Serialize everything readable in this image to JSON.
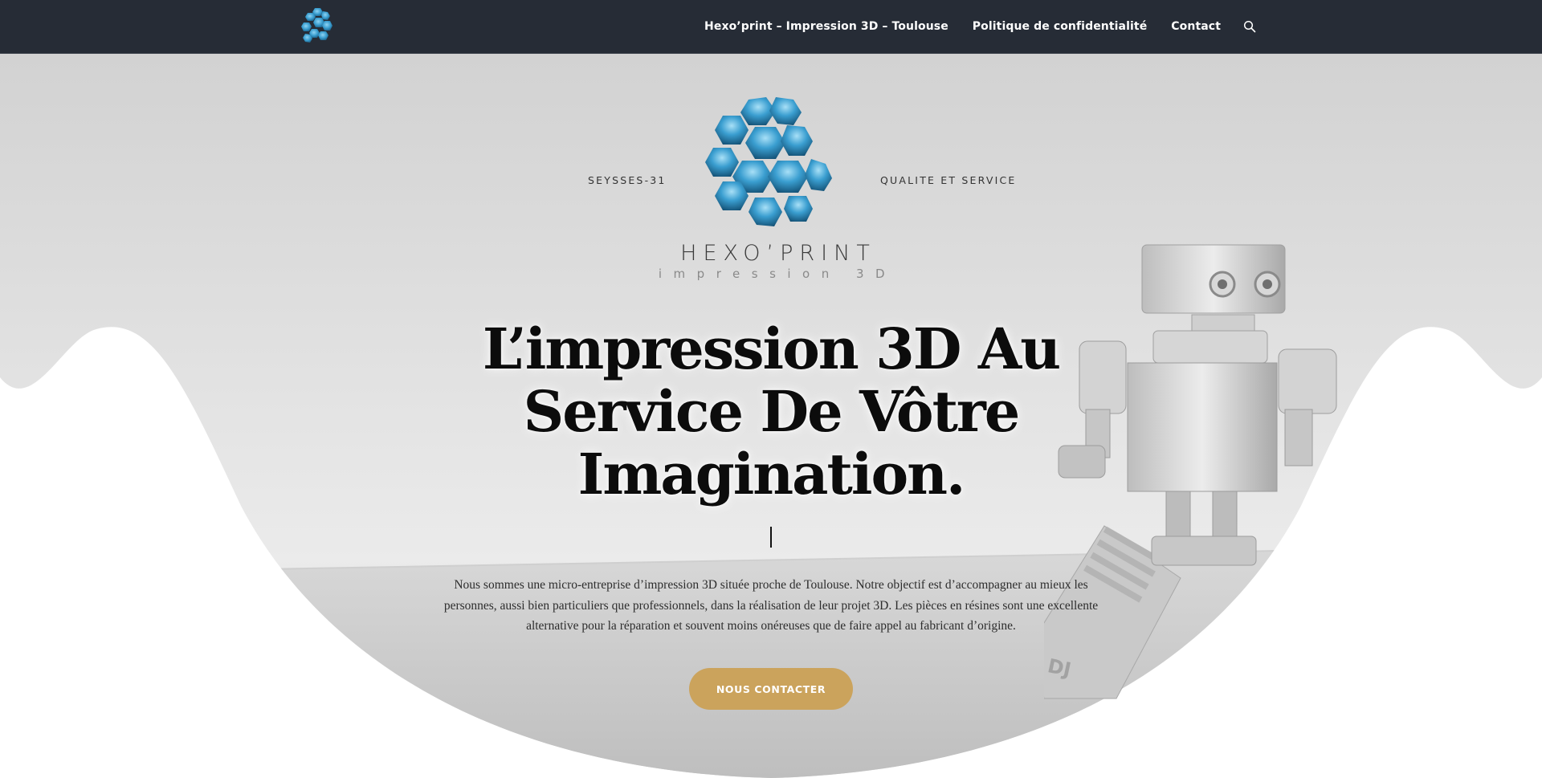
{
  "nav": {
    "logo_icon": "hexagon-sphere-logo",
    "links": [
      {
        "label": "Hexo’print – Impression 3D – Toulouse"
      },
      {
        "label": "Politique de confidentialité"
      },
      {
        "label": "Contact"
      }
    ],
    "search_icon": "search-icon"
  },
  "hero": {
    "tagline_left": "SEYSSES-31",
    "tagline_right": "QUALITE ET SERVICE",
    "brand_name": "HEXO’PRINT",
    "brand_sub": "impression 3D",
    "headline": "L’impression 3D Au Service De Vôtre Imagination.",
    "intro": "Nous sommes une micro-entreprise d’impression 3D située proche de Toulouse. Notre objectif est d’accompagner au mieux les personnes, aussi bien particuliers que professionnels, dans la réalisation de leur projet 3D. Les pièces en résines sont une excellente alternative pour la réparation et souvent moins onéreuses que de faire appel au fabricant d’origine.",
    "cta_label": "NOUS CONTACTER",
    "robot_block_letters": "DJ"
  },
  "colors": {
    "nav_bg": "#262c36",
    "accent": "#cba35c",
    "logo_blue": "#3a9ed0",
    "text_dark": "#0c0c0c"
  }
}
